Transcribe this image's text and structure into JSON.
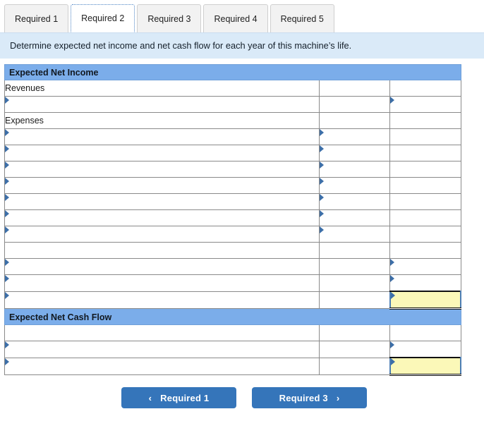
{
  "tabs": [
    {
      "label": "Required 1",
      "active": false
    },
    {
      "label": "Required 2",
      "active": true
    },
    {
      "label": "Required 3",
      "active": false
    },
    {
      "label": "Required 4",
      "active": false
    },
    {
      "label": "Required 5",
      "active": false
    }
  ],
  "instruction": {
    "text": "Determine expected net income and net cash flow for each year of this machine’s life."
  },
  "worksheet": {
    "sections": [
      {
        "title": "Expected Net Income"
      },
      {
        "title": "Expected Net Cash Flow"
      }
    ],
    "labels": {
      "revenues": "Revenues",
      "expenses": "Expenses"
    },
    "rows": {
      "net_income_revenue_input": {
        "col1": "",
        "col3": ""
      },
      "net_income_expense_inputs": [
        {
          "col1": "",
          "col2": ""
        },
        {
          "col1": "",
          "col2": ""
        },
        {
          "col1": "",
          "col2": ""
        },
        {
          "col1": "",
          "col2": ""
        },
        {
          "col1": "",
          "col2": ""
        },
        {
          "col1": "",
          "col2": ""
        },
        {
          "col1": "",
          "col2": ""
        }
      ],
      "net_income_totals": [
        {
          "col1": "",
          "col3": "",
          "total": false
        },
        {
          "col1": "",
          "col3": "",
          "total": false
        },
        {
          "col1": "",
          "col3": "",
          "total": true
        }
      ],
      "cash_flow_rows": [
        {
          "col1": "",
          "col3": "",
          "total": false
        },
        {
          "col1": "",
          "col3": "",
          "total": true
        }
      ]
    },
    "placeholder": ""
  },
  "nav": {
    "prev_label": "Required 1",
    "next_label": "Required 3",
    "prev_icon": "chevron-left-icon",
    "next_icon": "chevron-right-icon",
    "prev_chevron": "‹",
    "next_chevron": "›"
  },
  "colors": {
    "section_header_bg": "#7BADEA",
    "instruction_bg": "#DAEAF8",
    "input_border": "#4D7EB4",
    "total_bg": "#FBF8B8",
    "button_bg": "#3575BA"
  }
}
